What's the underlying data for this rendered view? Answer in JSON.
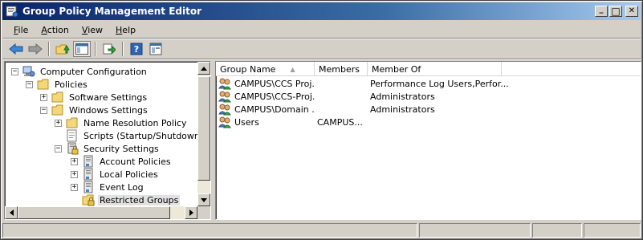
{
  "window": {
    "title": "Group Policy Management Editor",
    "minimize_glyph": "_",
    "maximize_glyph": "□",
    "close_glyph": "✕"
  },
  "menu": {
    "items": [
      {
        "label": "File",
        "accel": "F",
        "rest": "ile"
      },
      {
        "label": "Action",
        "accel": "A",
        "rest": "ction"
      },
      {
        "label": "View",
        "accel": "V",
        "rest": "iew"
      },
      {
        "label": "Help",
        "accel": "H",
        "rest": "elp"
      }
    ]
  },
  "toolbar": {
    "icons": [
      "back-arrow-icon",
      "forward-arrow-icon",
      "up-folder-icon",
      "show-hide-tree-icon",
      "export-list-icon",
      "help-icon",
      "properties-icon"
    ]
  },
  "tree": {
    "items": [
      {
        "label": "Computer Configuration",
        "expander": "−",
        "icon": "computer-icon",
        "depth": 0
      },
      {
        "label": "Policies",
        "expander": "−",
        "icon": "folder-icon",
        "depth": 1
      },
      {
        "label": "Software Settings",
        "expander": "+",
        "icon": "folder-icon",
        "depth": 2
      },
      {
        "label": "Windows Settings",
        "expander": "−",
        "icon": "folder-icon",
        "depth": 2
      },
      {
        "label": "Name Resolution Policy",
        "expander": "+",
        "icon": "folder-icon",
        "depth": 3
      },
      {
        "label": "Scripts (Startup/Shutdown)",
        "expander": "",
        "icon": "script-icon",
        "depth": 3
      },
      {
        "label": "Security Settings",
        "expander": "−",
        "icon": "security-settings-icon",
        "depth": 3
      },
      {
        "label": "Account Policies",
        "expander": "+",
        "icon": "policy-icon",
        "depth": 4
      },
      {
        "label": "Local Policies",
        "expander": "+",
        "icon": "policy-icon",
        "depth": 4
      },
      {
        "label": "Event Log",
        "expander": "+",
        "icon": "policy-icon",
        "depth": 4
      },
      {
        "label": "Restricted Groups",
        "expander": "",
        "icon": "restricted-groups-icon",
        "depth": 4,
        "selected": true
      }
    ]
  },
  "list": {
    "columns": [
      "Group Name",
      "Members",
      "Member Of"
    ],
    "sort_indicator": "▲",
    "rows": [
      {
        "group": "CAMPUS\\CCS Proj...",
        "members": "",
        "member_of": "Performance Log Users,Perfor..."
      },
      {
        "group": "CAMPUS\\CCS-Proj...",
        "members": "",
        "member_of": "Administrators"
      },
      {
        "group": "CAMPUS\\Domain ...",
        "members": "",
        "member_of": "Administrators"
      },
      {
        "group": "Users",
        "members": "CAMPUS...",
        "member_of": ""
      }
    ]
  },
  "colors": {
    "title_gradient_start": "#0a246a",
    "title_gradient_end": "#a6caf0",
    "face": "#d4d0c8"
  }
}
